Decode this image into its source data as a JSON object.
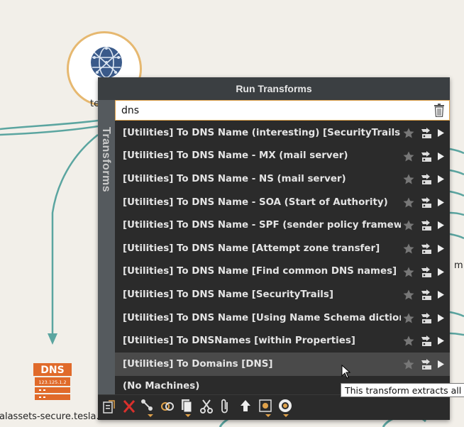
{
  "panel": {
    "title": "Run Transforms",
    "side_tab": "Transforms"
  },
  "search": {
    "value": "dns"
  },
  "transforms": [
    {
      "label": "[Utilities] To DNS Name (interesting) [SecurityTrails]"
    },
    {
      "label": "[Utilities] To DNS Name - MX (mail server)"
    },
    {
      "label": "[Utilities] To DNS Name - NS (mail server)"
    },
    {
      "label": "[Utilities] To DNS Name - SOA (Start of Authority)"
    },
    {
      "label": "[Utilities] To DNS Name - SPF (sender policy framework)"
    },
    {
      "label": "[Utilities] To DNS Name [Attempt zone transfer]"
    },
    {
      "label": "[Utilities] To DNS Name [Find common DNS names]"
    },
    {
      "label": "[Utilities] To DNS Name [SecurityTrails]"
    },
    {
      "label": "[Utilities] To DNS Name [Using Name Schema dictionary]"
    },
    {
      "label": "[Utilities] To DNSNames [within Properties]"
    },
    {
      "label": "[Utilities] To Domains [DNS]"
    }
  ],
  "machines_item": "(No Machines)",
  "tooltip": "This transform extracts all t",
  "graph": {
    "node_label_partial": "te",
    "dns_node_label": "alassets-secure.tesla.com",
    "dns_icon_text": "DNS",
    "dns_icon_ip": "123.125.1.2",
    "edge_label_partial": "m"
  },
  "colors": {
    "accent": "#e0a24a",
    "edge": "#5ba5a0",
    "dns_orange": "#e06a2a",
    "globe": "#3a5a8a"
  }
}
